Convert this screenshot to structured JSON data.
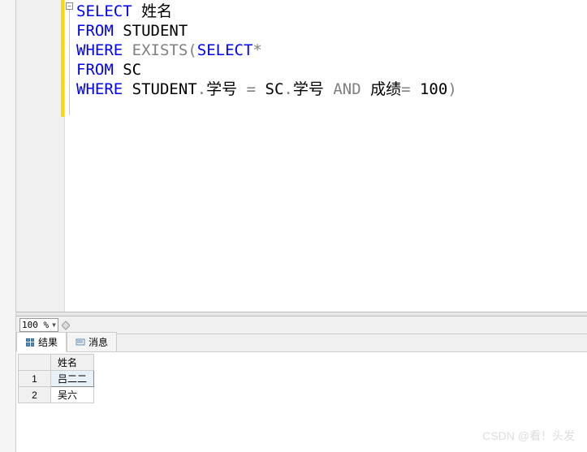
{
  "editor": {
    "code_tokens": [
      [
        {
          "t": "SELECT",
          "c": "kw"
        },
        {
          "t": " 姓名",
          "c": "txt"
        }
      ],
      [
        {
          "t": "FROM",
          "c": "kw"
        },
        {
          "t": " STUDENT",
          "c": "txt"
        }
      ],
      [
        {
          "t": "WHERE",
          "c": "kw"
        },
        {
          "t": " ",
          "c": "txt"
        },
        {
          "t": "EXISTS",
          "c": "gray"
        },
        {
          "t": "(",
          "c": "gray"
        },
        {
          "t": "SELECT",
          "c": "kw"
        },
        {
          "t": "*",
          "c": "gray"
        }
      ],
      [
        {
          "t": "FROM",
          "c": "kw"
        },
        {
          "t": " SC",
          "c": "txt"
        }
      ],
      [
        {
          "t": "WHERE",
          "c": "kw"
        },
        {
          "t": " STUDENT",
          "c": "txt"
        },
        {
          "t": ".",
          "c": "gray"
        },
        {
          "t": "学号 ",
          "c": "txt"
        },
        {
          "t": "=",
          "c": "gray"
        },
        {
          "t": " SC",
          "c": "txt"
        },
        {
          "t": ".",
          "c": "gray"
        },
        {
          "t": "学号 ",
          "c": "txt"
        },
        {
          "t": "AND",
          "c": "gray"
        },
        {
          "t": " 成绩",
          "c": "txt"
        },
        {
          "t": "=",
          "c": "gray"
        },
        {
          "t": " 100",
          "c": "txt"
        },
        {
          "t": ")",
          "c": "gray"
        }
      ]
    ],
    "collapse_symbol": "−"
  },
  "zoom": {
    "value": "100 %"
  },
  "tabs": {
    "results": "结果",
    "messages": "消息"
  },
  "results": {
    "columns": [
      "姓名"
    ],
    "rows": [
      {
        "n": "1",
        "cells": [
          "吕二二"
        ]
      },
      {
        "n": "2",
        "cells": [
          "吴六"
        ]
      }
    ]
  },
  "watermark": "CSDN @看！头发",
  "chart_data": {
    "type": "table",
    "title": "Query Results",
    "columns": [
      "姓名"
    ],
    "rows": [
      [
        "吕二二"
      ],
      [
        "吴六"
      ]
    ]
  }
}
